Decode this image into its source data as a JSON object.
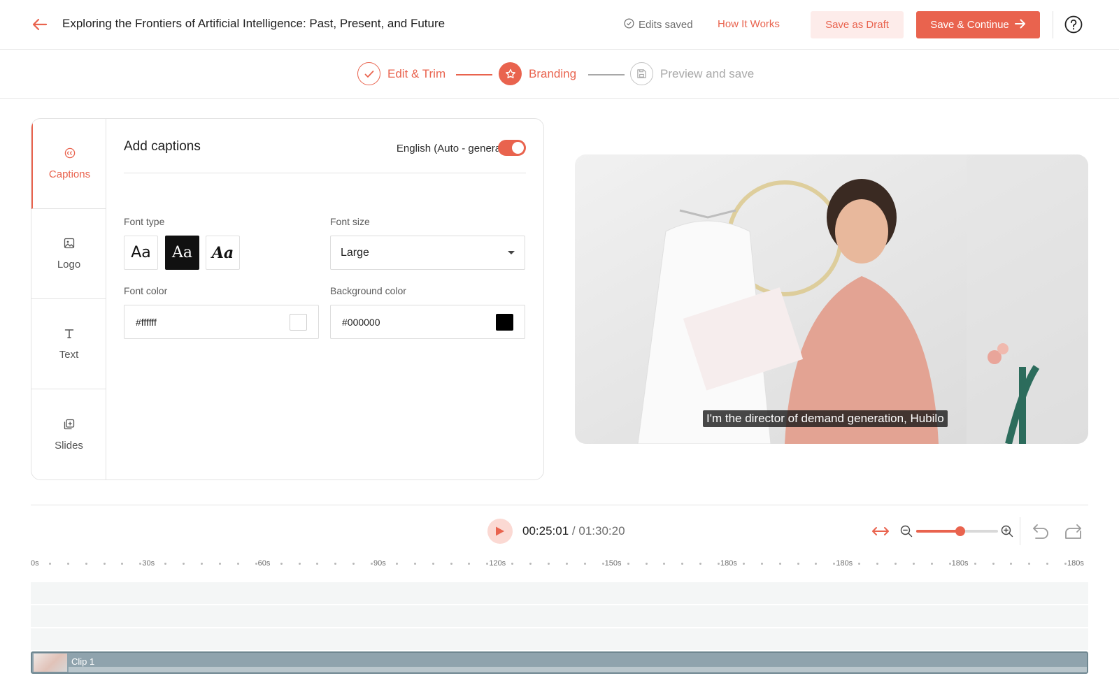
{
  "header": {
    "title": "Exploring the Frontiers of Artificial Intelligence: Past, Present, and Future",
    "status": "Edits saved",
    "how_it_works": "How It Works",
    "save_draft": "Save as Draft",
    "save_continue": "Save & Continue"
  },
  "stepper": {
    "steps": [
      {
        "label": "Edit & Trim",
        "state": "completed"
      },
      {
        "label": "Branding",
        "state": "active"
      },
      {
        "label": "Preview and save",
        "state": "pending"
      }
    ]
  },
  "sidenav": {
    "items": [
      {
        "label": "Captions",
        "icon": "cc-icon",
        "active": true
      },
      {
        "label": "Logo",
        "icon": "image-icon",
        "active": false
      },
      {
        "label": "Text",
        "icon": "text-icon",
        "active": false
      },
      {
        "label": "Slides",
        "icon": "slides-icon",
        "active": false
      }
    ]
  },
  "captions": {
    "title": "Add captions",
    "language": "English (Auto - generated)",
    "enabled": true,
    "font_type_label": "Font type",
    "font_types": [
      "Aa",
      "Aa",
      "Aa"
    ],
    "font_type_selected": 1,
    "font_size_label": "Font size",
    "font_size_value": "Large",
    "font_color_label": "Font color",
    "font_color_value": "#ffffff",
    "bg_color_label": "Background color",
    "bg_color_value": "#000000"
  },
  "preview": {
    "caption_text": "I'm the director of demand generation, Hubilo"
  },
  "player": {
    "current_time": "00:25:01",
    "total_time": "/ 01:30:20",
    "zoom_level": 0.54
  },
  "ruler": {
    "labels": [
      "0s",
      "30s",
      "60s",
      "90s",
      "120s",
      "150s",
      "180s",
      "180s",
      "180s",
      "180s"
    ]
  },
  "timeline": {
    "clip_label": "Clip 1"
  },
  "colors": {
    "accent": "#e9634e",
    "accent_light": "#fdecea"
  }
}
